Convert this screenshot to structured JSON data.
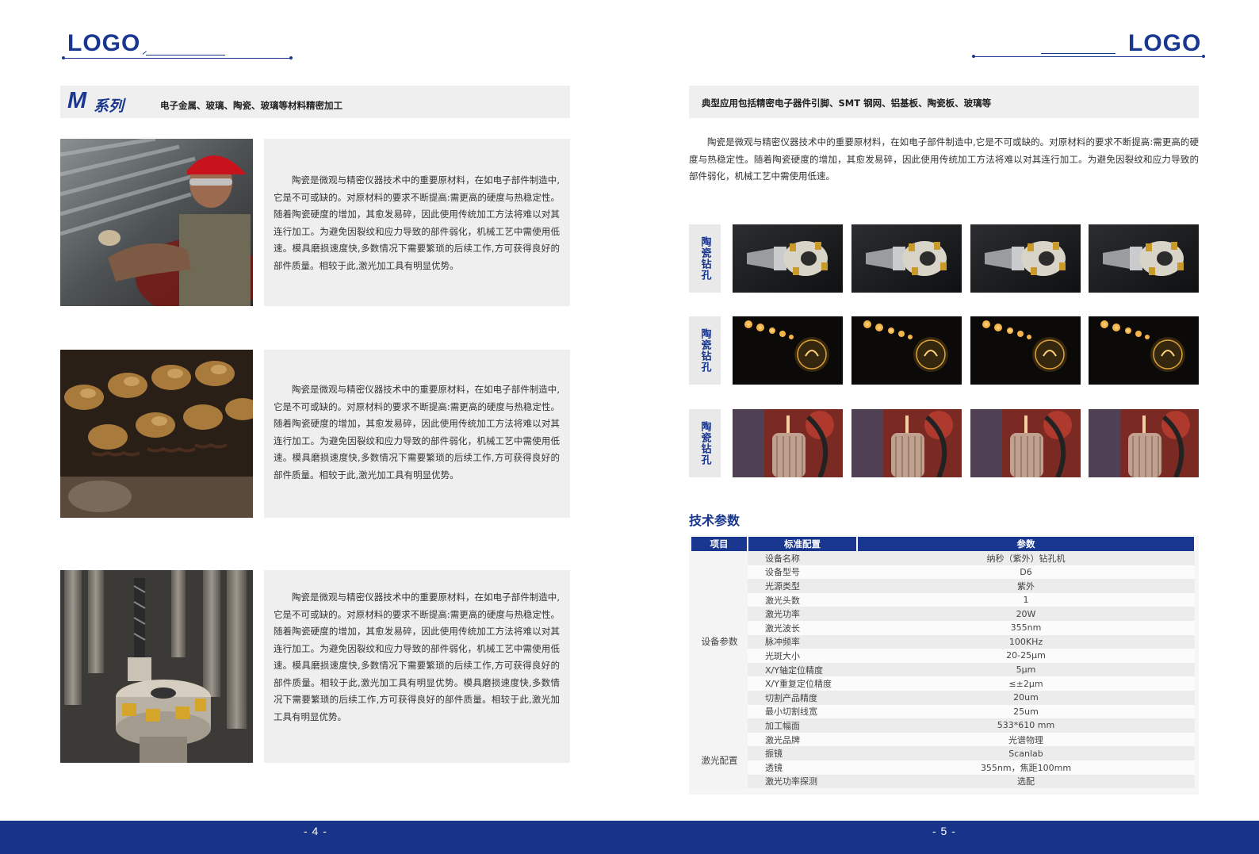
{
  "header": {
    "left_logo": "LOGO",
    "right_logo": "LOGO"
  },
  "left_page": {
    "series_title": "M",
    "series_suffix": "系列",
    "series_subtitle": "电子金属、玻璃、陶瓷、玻璃等材料精密加工",
    "blocks": [
      {
        "image": "worker-photo",
        "text": "陶瓷是微观与精密仪器技术中的重要原材料，在如电子部件制造中,它是不可或缺的。对原材料的要求不断提高:需更高的硬度与热稳定性。随着陶瓷硬度的增加，其愈发易碎，因此使用传统加工方法将难以对其连行加工。为避免因裂纹和应力导致的部件弱化，机械工艺中需使用低速。模具磨损速度快,多数情况下需要繁琐的后续工作,方可获得良好的部件质量。相较于此,激光加工具有明显优势。"
      },
      {
        "image": "engine-valves-photo",
        "text": "陶瓷是微观与精密仪器技术中的重要原材料，在如电子部件制造中,它是不可或缺的。对原材料的要求不断提高:需更高的硬度与热稳定性。随着陶瓷硬度的增加，其愈发易碎，因此使用传统加工方法将难以对其连行加工。为避免因裂纹和应力导致的部件弱化，机械工艺中需使用低速。模具磨损速度快,多数情况下需要繁琐的后续工作,方可获得良好的部件质量。相较于此,激光加工具有明显优势。"
      },
      {
        "image": "milling-tool-photo",
        "text": "陶瓷是微观与精密仪器技术中的重要原材料，在如电子部件制造中,它是不可或缺的。对原材料的要求不断提高:需更高的硬度与热稳定性。随着陶瓷硬度的增加，其愈发易碎，因此使用传统加工方法将难以对其连行加工。为避免因裂纹和应力导致的部件弱化，机械工艺中需使用低速。模具磨损速度快,多数情况下需要繁琐的后续工作,方可获得良好的部件质量。相较于此,激光加工具有明显优势。模具磨损速度快,多数情况下需要繁琐的后续工作,方可获得良好的部件质量。相较于此,激光加工具有明显优势。"
      }
    ],
    "page_number": "- 4 -"
  },
  "right_page": {
    "banner": "典型应用包括精密电子器件引脚、SMT 钢网、铝基板、陶瓷板、玻璃等",
    "intro": "陶瓷是微观与精密仪器技术中的重要原材料，在如电子部件制造中,它是不可或缺的。对原材料的要求不断提高:需更高的硬度与热稳定性。随着陶瓷硬度的增加，其愈发易碎，因此使用传统加工方法将难以对其连行加工。为避免因裂纹和应力导致的部件弱化，机械工艺中需使用低速。",
    "gallery_rows": [
      {
        "label": "陶瓷钻孔",
        "image": "milling-tool-dark"
      },
      {
        "label": "陶瓷钻孔",
        "image": "light-bulbs"
      },
      {
        "label": "陶瓷钻孔",
        "image": "microphone-red"
      }
    ],
    "spec_title": "技术参数",
    "spec_table": {
      "headers": [
        "项目",
        "标准配置",
        "参数"
      ],
      "groups": [
        {
          "category": "设备参数",
          "rows": [
            [
              "设备名称",
              "纳秒（紫外）钻孔机"
            ],
            [
              "设备型号",
              "D6"
            ],
            [
              "光源类型",
              "紫外"
            ],
            [
              "激光头数",
              "1"
            ],
            [
              "激光功率",
              "20W"
            ],
            [
              "激光波长",
              "355nm"
            ],
            [
              "脉冲频率",
              "100KHz"
            ],
            [
              "光斑大小",
              "20-25μm"
            ],
            [
              "X/Y轴定位精度",
              "5μm"
            ],
            [
              "X/Y重复定位精度",
              "≤±2μm"
            ],
            [
              "切割产品精度",
              "20um"
            ],
            [
              "最小切割线宽",
              "25um"
            ],
            [
              "加工幅面",
              "533*610 mm"
            ]
          ]
        },
        {
          "category": "激光配置",
          "rows": [
            [
              "激光品牌",
              "光谱物理"
            ],
            [
              "振镜",
              "Scanlab"
            ],
            [
              "透镜",
              "355nm，焦距100mm"
            ],
            [
              "激光功率探测",
              "选配"
            ]
          ]
        }
      ]
    },
    "page_number": "- 5 -"
  },
  "colors": {
    "brand_blue": "#1a3790",
    "footer_blue": "#17348a",
    "panel_grey": "#efefef"
  }
}
